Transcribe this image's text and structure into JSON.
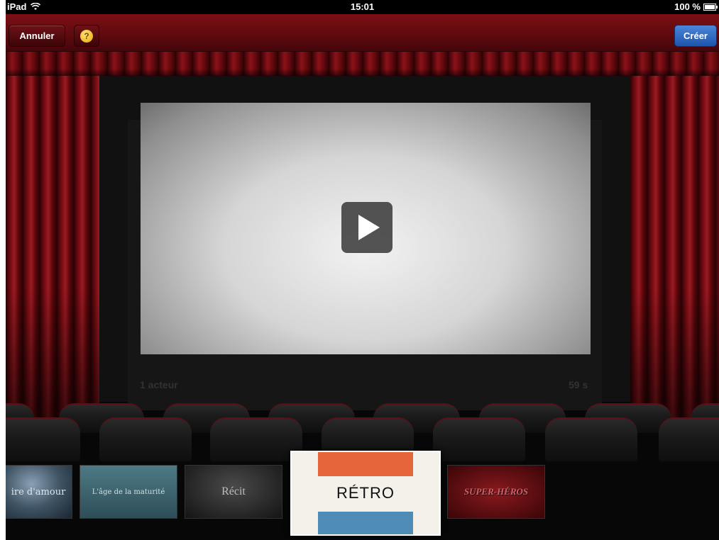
{
  "status_bar": {
    "device": "iPad",
    "time": "15:01",
    "battery": "100 %"
  },
  "toolbar": {
    "cancel_label": "Annuler",
    "help_label": "?",
    "create_label": "Créer"
  },
  "preview": {
    "actors": "1 acteur",
    "duration": "59 s"
  },
  "themes": [
    {
      "label": "ire d'amour"
    },
    {
      "label": "L'âge de la maturité"
    },
    {
      "label": "Récit"
    },
    {
      "label": "RÉTRO"
    },
    {
      "label": "SUPER-HÉROS"
    }
  ],
  "colors": {
    "toolbar": "#5f0a0f",
    "create_button": "#2b66c4",
    "curtain": "#8a1219",
    "retro_orange": "#e5663a",
    "retro_blue": "#4f8cb6"
  }
}
